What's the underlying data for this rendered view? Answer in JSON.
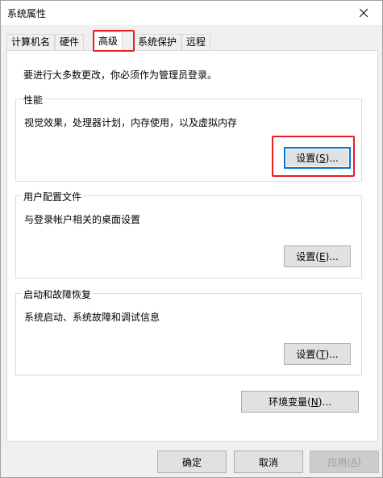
{
  "window": {
    "title": "系统属性",
    "close_glyph": "✕"
  },
  "tabs": [
    {
      "label": "计算机名",
      "active": false
    },
    {
      "label": "硬件",
      "active": false
    },
    {
      "label": "高级",
      "active": true
    },
    {
      "label": "系统保护",
      "active": false
    },
    {
      "label": "远程",
      "active": false
    }
  ],
  "panel": {
    "intro": "要进行大多数更改，你必须作为管理员登录。",
    "performance": {
      "title": "性能",
      "description": "视觉效果，处理器计划，内存使用，以及虚拟内存",
      "button_prefix": "设置(",
      "button_key": "S",
      "button_suffix": ")..."
    },
    "user_profiles": {
      "title": "用户配置文件",
      "description": "与登录帐户相关的桌面设置",
      "button_prefix": "设置(",
      "button_key": "E",
      "button_suffix": ")..."
    },
    "startup_recovery": {
      "title": "启动和故障恢复",
      "description": "系统启动、系统故障和调试信息",
      "button_prefix": "设置(",
      "button_key": "T",
      "button_suffix": ")..."
    },
    "env_button": {
      "prefix": "环境变量(",
      "key": "N",
      "suffix": ")..."
    }
  },
  "footer": {
    "ok": "确定",
    "cancel": "取消",
    "apply_prefix": "应用(",
    "apply_key": "A",
    "apply_suffix": ")"
  },
  "colors": {
    "highlight": "#e81e24",
    "focus": "#0078d7",
    "panel_bg": "#ffffff",
    "window_bg": "#f0f0f0"
  },
  "icons": {
    "close": "close-icon"
  }
}
